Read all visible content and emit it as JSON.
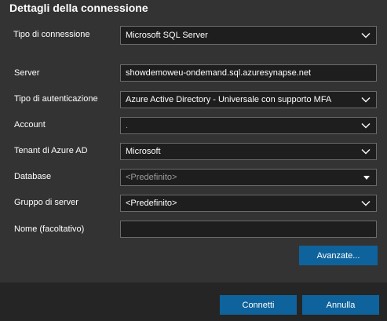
{
  "dialog": {
    "title": "Dettagli della connessione"
  },
  "form": {
    "connection_type": {
      "label": "Tipo di connessione",
      "value": "Microsoft SQL Server"
    },
    "server": {
      "label": "Server",
      "value": "showdemoweu-ondemand.sql.azuresynapse.net"
    },
    "auth_type": {
      "label": "Tipo di autenticazione",
      "value": "Azure Active Directory - Universale con supporto MFA"
    },
    "account": {
      "label": "Account",
      "value": "."
    },
    "tenant": {
      "label": "Tenant di Azure AD",
      "value": "Microsoft"
    },
    "database": {
      "label": "Database",
      "value": "<Predefinito>"
    },
    "server_group": {
      "label": "Gruppo di server",
      "value": "<Predefinito>"
    },
    "name": {
      "label": "Nome (facoltativo)",
      "value": ""
    }
  },
  "buttons": {
    "advanced": "Avanzate...",
    "connect": "Connetti",
    "cancel": "Annulla"
  },
  "icons": {
    "dropdown": "chevron-down-icon",
    "combo": "caret-down-icon"
  },
  "colors": {
    "background": "#333333",
    "input_background": "#1e1e1e",
    "button": "#0e639c"
  }
}
